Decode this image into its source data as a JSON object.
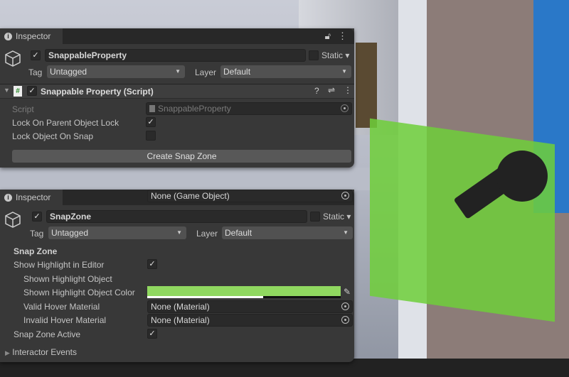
{
  "panels": [
    {
      "tab": "Inspector",
      "object_name": "SnappableProperty",
      "active": true,
      "static_label": "Static",
      "tag_label": "Tag",
      "tag": "Untagged",
      "layer_label": "Layer",
      "layer": "Default",
      "component": {
        "title": "Snappable Property (Script)",
        "enabled": true,
        "script_label": "Script",
        "script_value": "SnappableProperty",
        "fields": [
          {
            "label": "Lock On Parent Object Lock",
            "checked": true
          },
          {
            "label": "Lock Object On Snap",
            "checked": false
          }
        ],
        "button": "Create Snap Zone"
      }
    },
    {
      "tab": "Inspector",
      "object_name": "SnapZone",
      "active": true,
      "static_label": "Static",
      "tag_label": "Tag",
      "tag": "Untagged",
      "layer_label": "Layer",
      "layer": "Default",
      "section": "Snap Zone",
      "fields": [
        {
          "label": "Show Highlight in Editor",
          "checked": true
        },
        {
          "label": "Shown Highlight Object",
          "value": "None (Game Object)"
        },
        {
          "label": "Shown Highlight Object Color",
          "color": "#90d860",
          "alpha": 0.6
        },
        {
          "label": "Valid Hover Material",
          "value": "None (Material)"
        },
        {
          "label": "Invalid Hover Material",
          "value": "None (Material)"
        },
        {
          "label": "Snap Zone Active",
          "checked": true
        }
      ],
      "foldout": "Interactor Events"
    }
  ]
}
